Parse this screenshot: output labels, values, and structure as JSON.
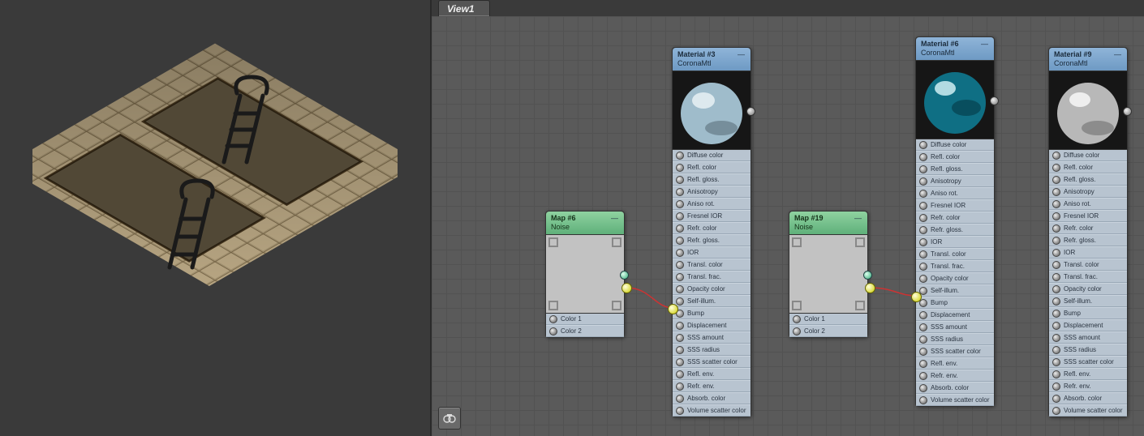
{
  "tabbar": {
    "tab1": "View1"
  },
  "toolbar": {
    "btn1_name": "material-picker"
  },
  "nodes": {
    "map6": {
      "title": "Map #6",
      "sub": "Noise",
      "slots": [
        "Color 1",
        "Color 2"
      ]
    },
    "map19": {
      "title": "Map #19",
      "sub": "Noise",
      "slots": [
        "Color 1",
        "Color 2"
      ]
    },
    "mat3": {
      "title": "Material #3",
      "sub": "CoronaMtl",
      "slots": [
        "Diffuse color",
        "Refl. color",
        "Refl. gloss.",
        "Anisotropy",
        "Aniso rot.",
        "Fresnel IOR",
        "Refr. color",
        "Refr. gloss.",
        "IOR",
        "Transl. color",
        "Transl. frac.",
        "Opacity color",
        "Self-illum.",
        "Bump",
        "Displacement",
        "SSS amount",
        "SSS radius",
        "SSS scatter color",
        "Refl. env.",
        "Refr. env.",
        "Absorb. color",
        "Volume scatter color"
      ]
    },
    "mat6": {
      "title": "Material #6",
      "sub": "CoronaMtl",
      "slots": [
        "Diffuse color",
        "Refl. color",
        "Refl. gloss.",
        "Anisotropy",
        "Aniso rot.",
        "Fresnel IOR",
        "Refr. color",
        "Refr. gloss.",
        "IOR",
        "Transl. color",
        "Transl. frac.",
        "Opacity color",
        "Self-illum.",
        "Bump",
        "Displacement",
        "SSS amount",
        "SSS radius",
        "SSS scatter color",
        "Refl. env.",
        "Refr. env.",
        "Absorb. color",
        "Volume scatter color"
      ]
    },
    "mat9": {
      "title": "Material #9",
      "sub": "CoronaMtl",
      "slots": [
        "Diffuse color",
        "Refl. color",
        "Refl. gloss.",
        "Anisotropy",
        "Aniso rot.",
        "Fresnel IOR",
        "Refr. color",
        "Refr. gloss.",
        "IOR",
        "Transl. color",
        "Transl. frac.",
        "Opacity color",
        "Self-illum.",
        "Bump",
        "Displacement",
        "SSS amount",
        "SSS radius",
        "SSS scatter color",
        "Refl. env.",
        "Refr. env.",
        "Absorb. color",
        "Volume scatter color"
      ]
    }
  },
  "colors": {
    "mat3_sphere": "#9fbccb",
    "mat6_sphere": "#0f6f84",
    "mat9_sphere": "#b8b8b8"
  }
}
